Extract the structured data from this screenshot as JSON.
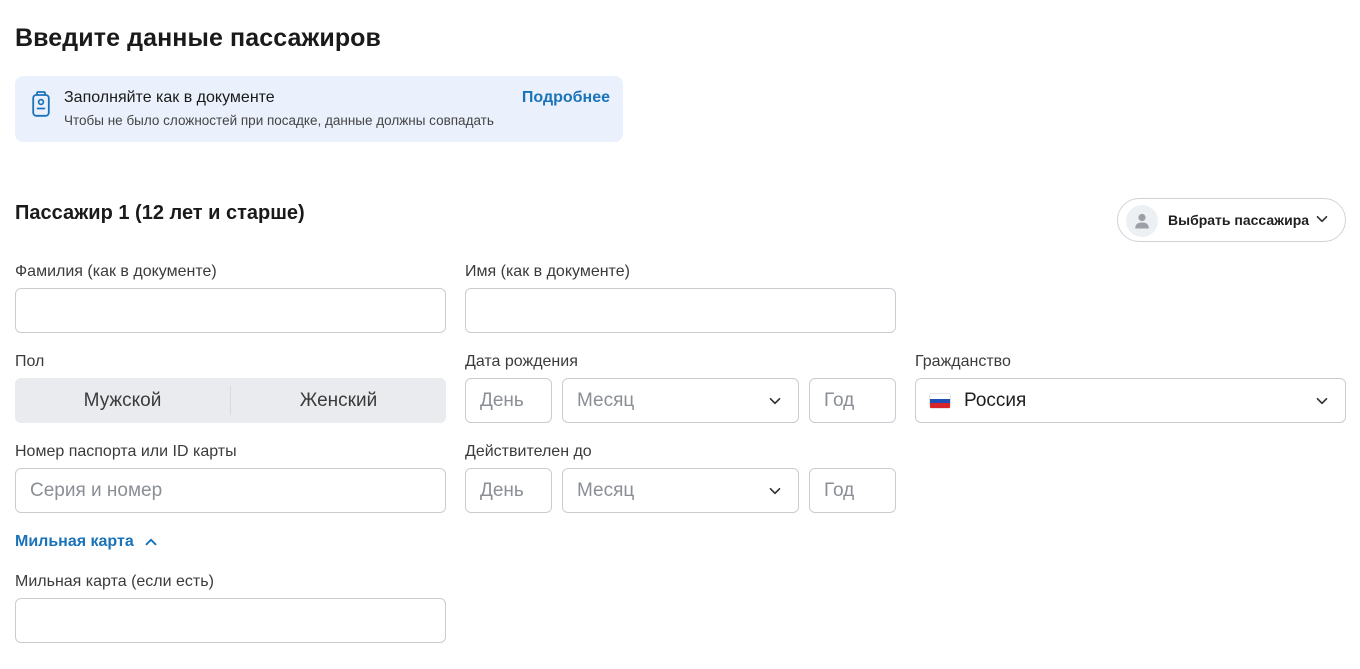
{
  "page": {
    "title": "Введите данные пассажиров"
  },
  "notice": {
    "title": "Заполняйте как в документе",
    "subtitle": "Чтобы не было сложностей при посадке, данные должны совпадать",
    "link": "Подробнее",
    "icon": "passport-icon",
    "background": "#eaf1fd"
  },
  "passenger": {
    "title": "Пассажир 1 (12 лет и старше)",
    "pick_button": "Выбрать пассажира",
    "surname": {
      "label": "Фамилия (как в документе)",
      "value": "",
      "placeholder": ""
    },
    "name": {
      "label": "Имя (как в документе)",
      "value": "",
      "placeholder": ""
    },
    "gender": {
      "label": "Пол",
      "options": [
        "Мужской",
        "Женский"
      ]
    },
    "birth_date": {
      "label": "Дата рождения",
      "day_placeholder": "День",
      "month_placeholder": "Месяц",
      "year_placeholder": "Год"
    },
    "citizenship": {
      "label": "Гражданство",
      "value": "Россия",
      "flag": "ru-flag-icon"
    },
    "passport": {
      "label": "Номер паспорта или ID карты",
      "placeholder": "Серия и номер"
    },
    "valid_until": {
      "label": "Действителен до",
      "day_placeholder": "День",
      "month_placeholder": "Месяц",
      "year_placeholder": "Год"
    },
    "miles": {
      "toggle": "Мильная карта",
      "label": "Мильная карта (если есть)",
      "value": ""
    }
  },
  "colors": {
    "accent": "#1a73b8",
    "border": "#c9cdd2",
    "segmented_bg": "#e9ebee"
  }
}
